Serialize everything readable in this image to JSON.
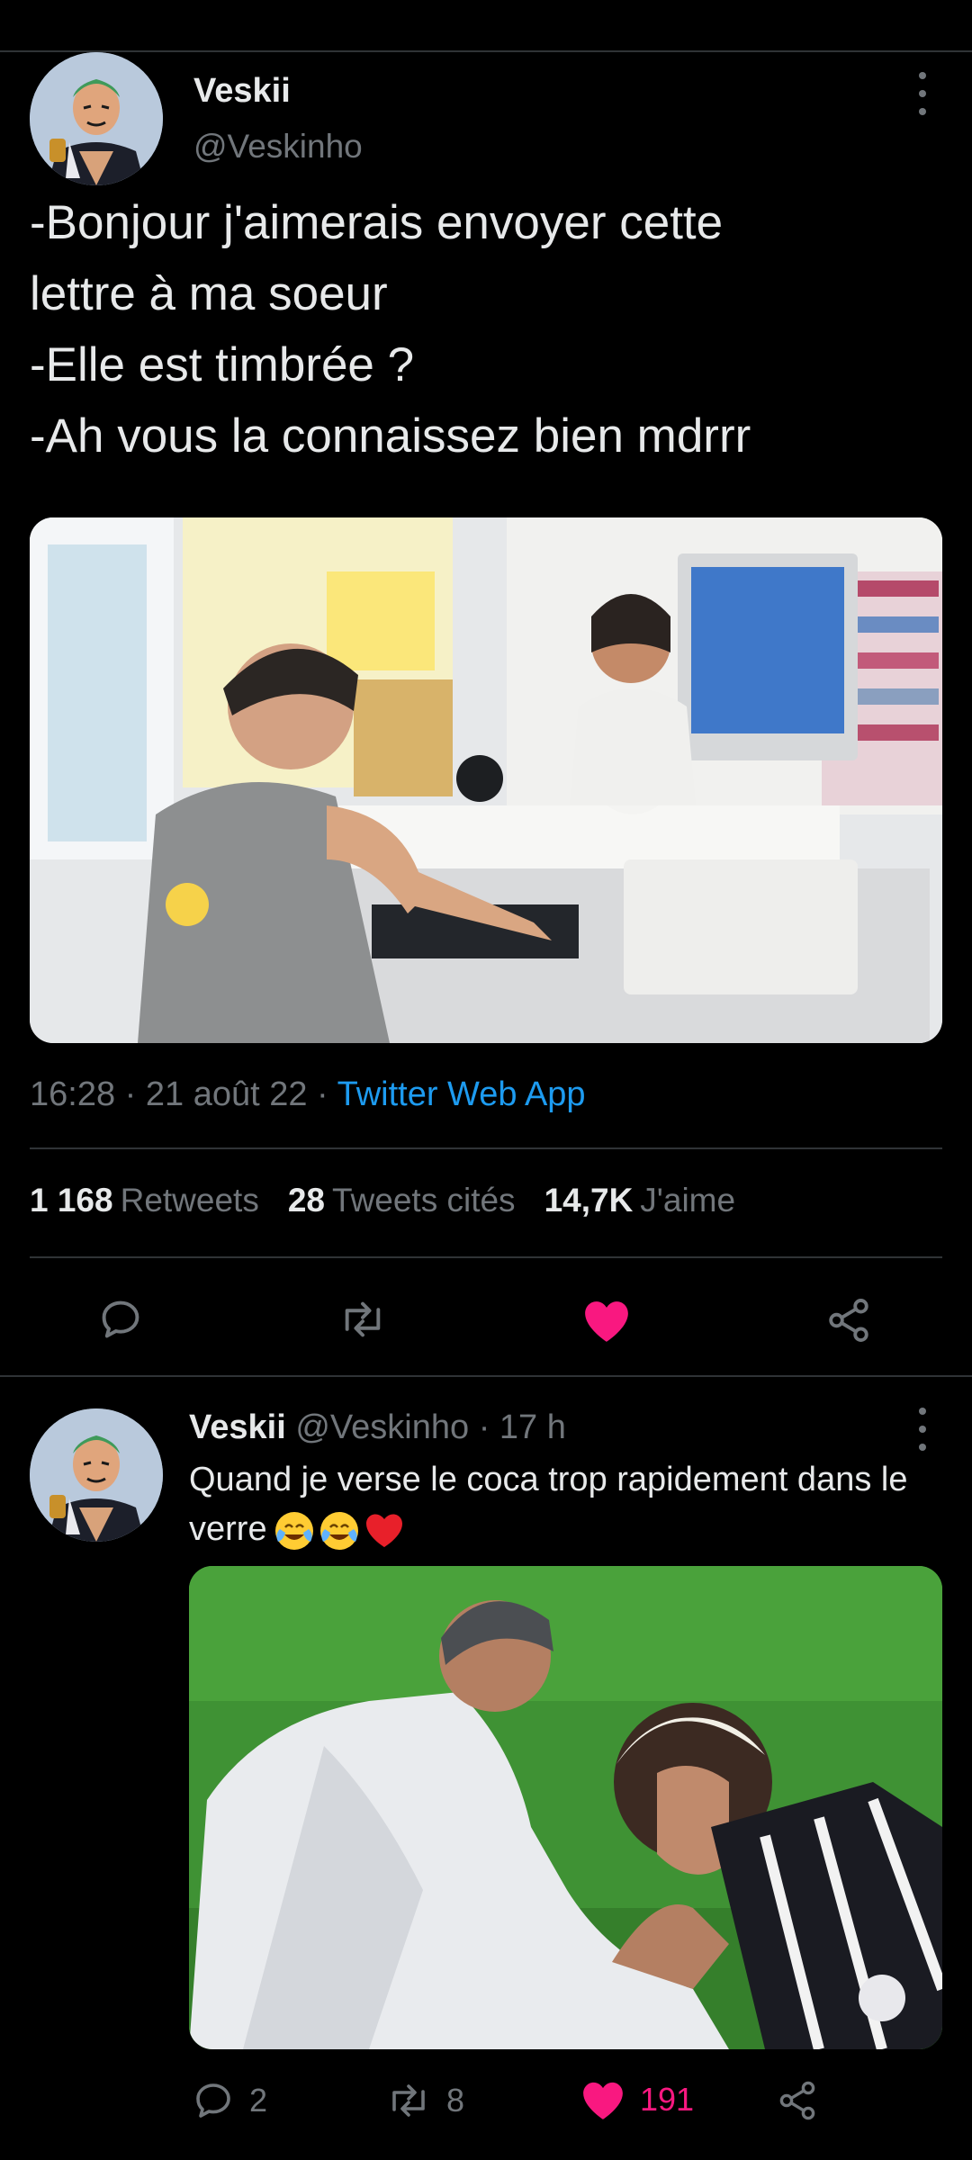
{
  "main_tweet": {
    "display_name": "Veskii",
    "handle": "@Veskinho",
    "text": "-Bonjour j'aimerais envoyer cette\nlettre à ma soeur\n-Elle est timbrée ?\n-Ah vous la connaissez bien mdrrr",
    "time": "16:28",
    "date": "21 août 22",
    "separator": " · ",
    "app": "Twitter Web App",
    "stats": {
      "retweets_count": "1 168",
      "retweets_label": "Retweets",
      "quotes_count": "28",
      "quotes_label": "Tweets cités",
      "likes_count": "14,7K",
      "likes_label": "J'aime"
    },
    "liked": true
  },
  "reply_tweet": {
    "display_name": "Veskii",
    "handle": "@Veskinho",
    "time_ago": "17 h",
    "text": "Quand je verse le coca trop rapidement dans le verre",
    "emojis": [
      "face-with-tears-of-joy",
      "face-with-tears-of-joy",
      "red-heart"
    ],
    "replies": "2",
    "retweets": "8",
    "likes": "191",
    "liked": true
  },
  "colors": {
    "background": "#000000",
    "text": "#e7e9ea",
    "muted": "#71767b",
    "link": "#1d9bf0",
    "like": "#f91880",
    "divider": "#2f3336"
  }
}
